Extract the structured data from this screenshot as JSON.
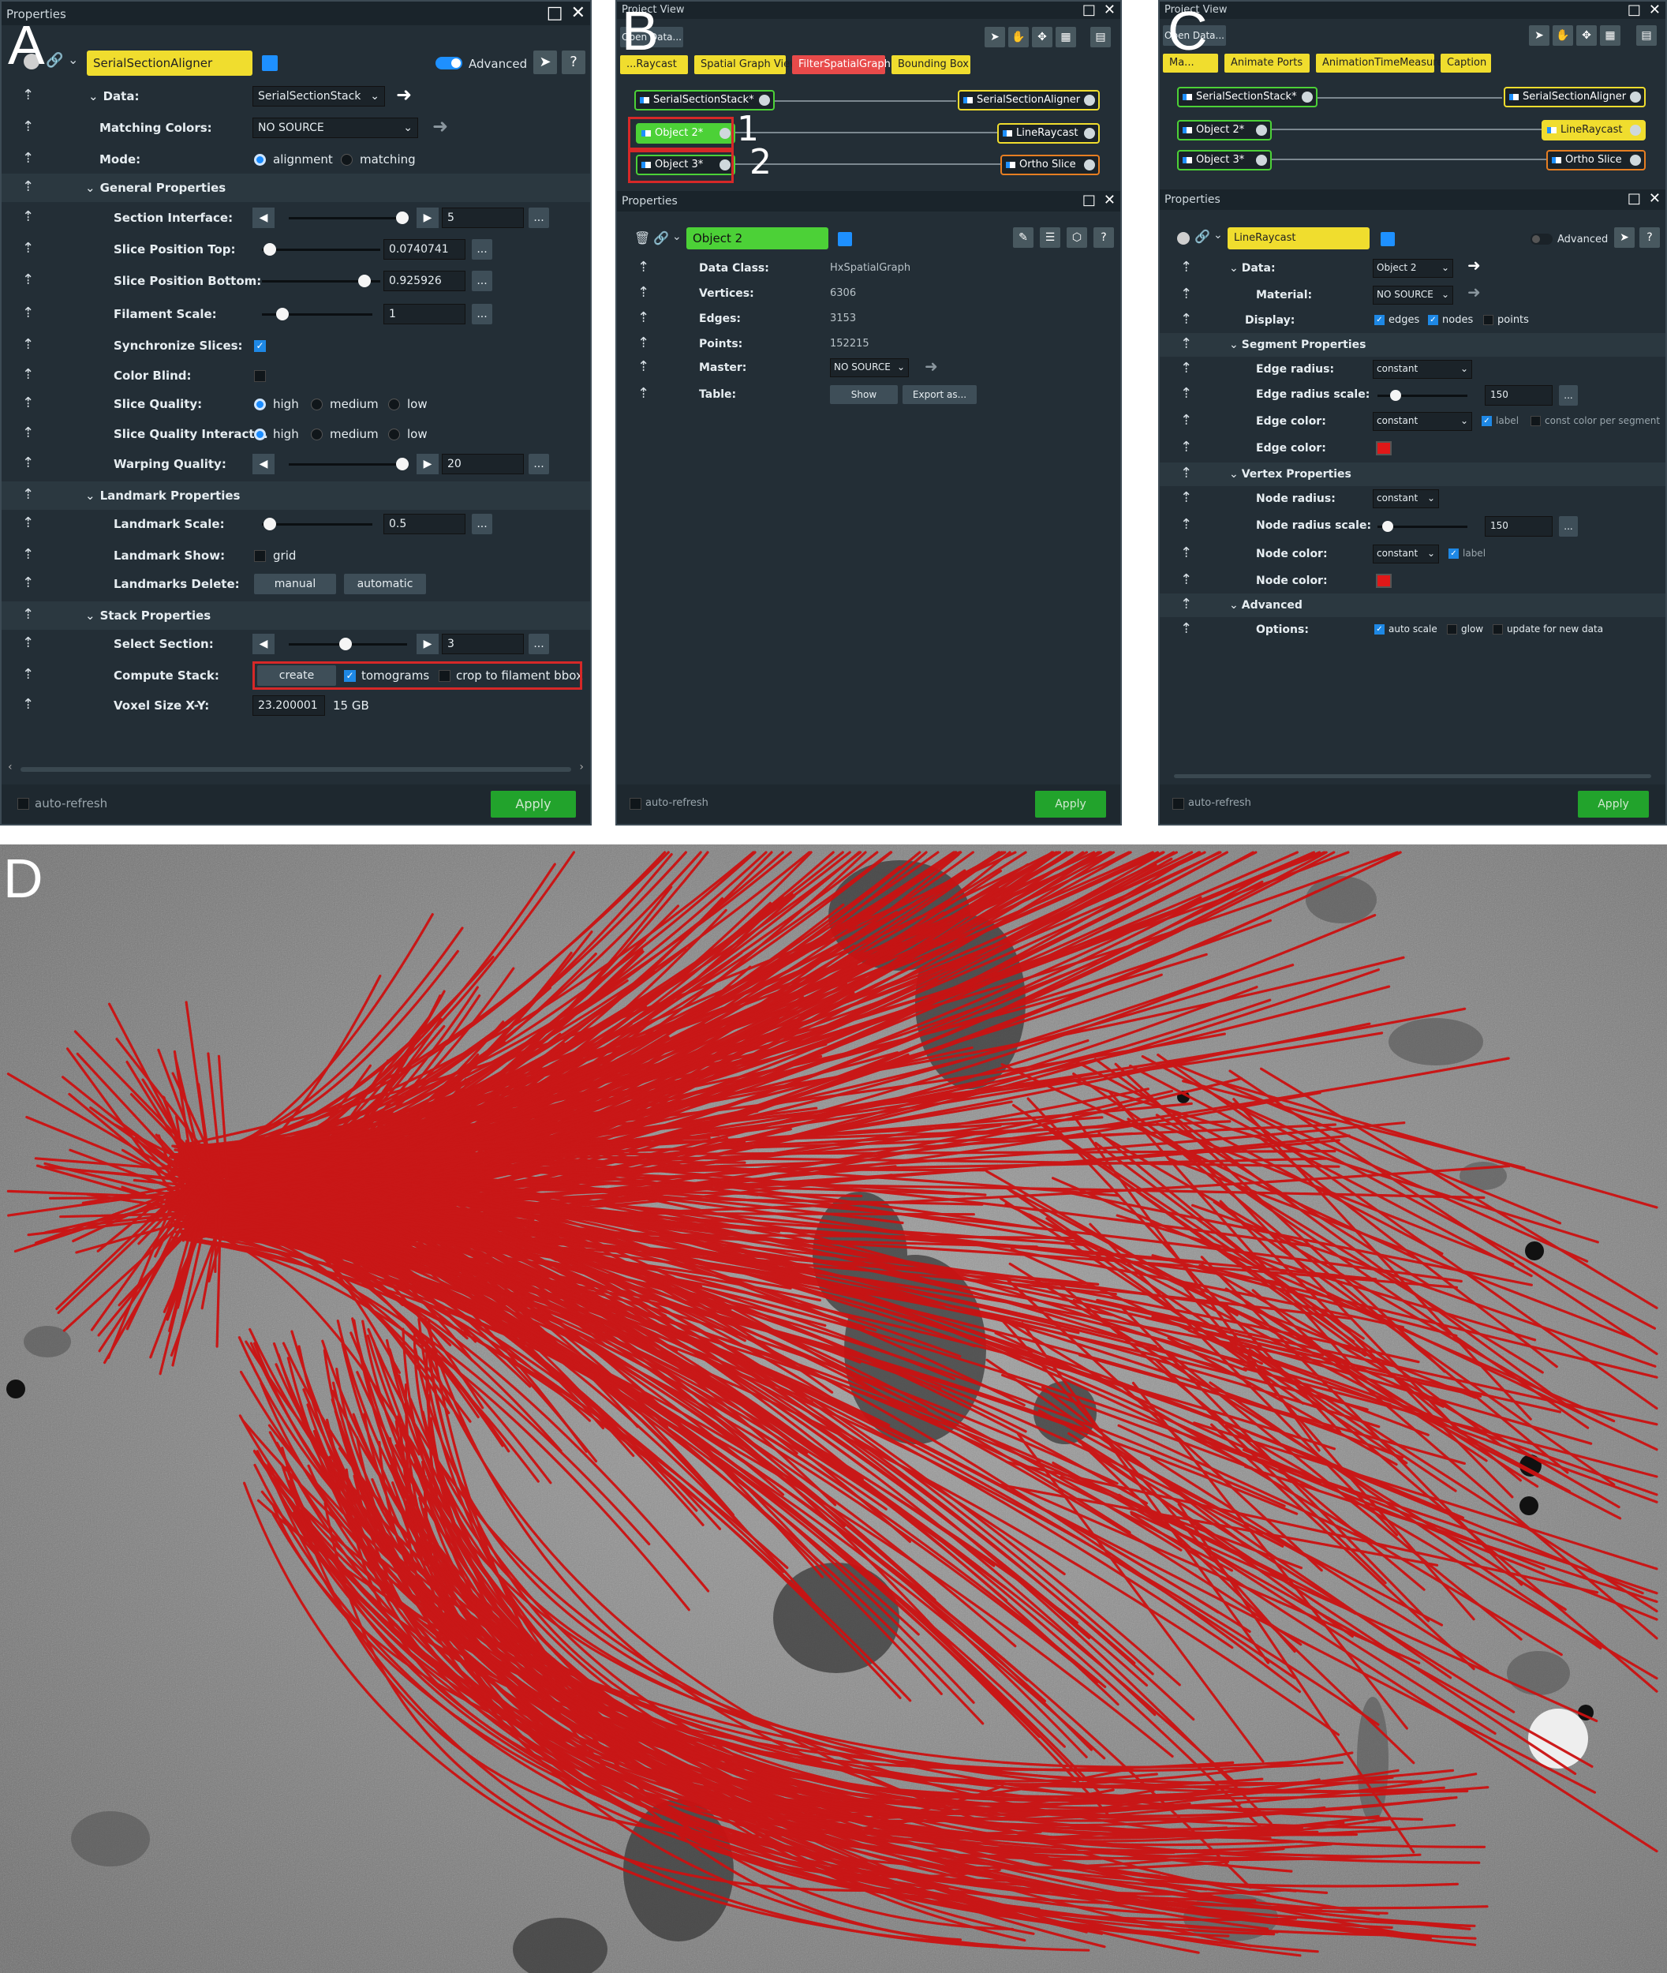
{
  "figure_labels": {
    "a": "A",
    "b": "B",
    "c": "C",
    "d": "D"
  },
  "panel_a": {
    "window_title": "Properties",
    "module_name": "SerialSectionAligner",
    "advanced_label": "Advanced",
    "rows": {
      "data_label": "Data:",
      "data_value": "SerialSectionStack",
      "matching_colors_label": "Matching Colors:",
      "matching_colors_value": "NO SOURCE",
      "mode_label": "Mode:",
      "mode_opt1": "alignment",
      "mode_opt2": "matching",
      "general_header": "General Properties",
      "section_interface_label": "Section Interface:",
      "section_interface_value": "5",
      "slice_top_label": "Slice Position Top:",
      "slice_top_value": "0.0740741",
      "slice_bottom_label": "Slice Position Bottom:",
      "slice_bottom_value": "0.925926",
      "filament_scale_label": "Filament Scale:",
      "filament_scale_value": "1",
      "sync_label": "Synchronize Slices:",
      "color_blind_label": "Color Blind:",
      "slice_quality_label": "Slice Quality:",
      "slice_quality_interact_label": "Slice Quality Interact...",
      "q_high": "high",
      "q_medium": "medium",
      "q_low": "low",
      "warping_label": "Warping Quality:",
      "warping_value": "20",
      "landmark_header": "Landmark Properties",
      "landmark_scale_label": "Landmark Scale:",
      "landmark_scale_value": "0.5",
      "landmark_show_label": "Landmark Show:",
      "landmark_show_opt": "grid",
      "landmarks_delete_label": "Landmarks Delete:",
      "manual_button": "manual",
      "automatic_button": "automatic",
      "stack_header": "Stack Properties",
      "select_section_label": "Select Section:",
      "select_section_value": "3",
      "compute_stack_label": "Compute Stack:",
      "create_button": "create",
      "tomograms_label": "tomograms",
      "crop_label": "crop to filament bbox",
      "voxel_label": "Voxel Size X-Y:",
      "voxel_value": "23.200001",
      "voxel_mem": "15 GB"
    },
    "auto_refresh": "auto-refresh",
    "apply": "Apply"
  },
  "panel_b": {
    "project_title": "Project View",
    "open_data": "Open Data...",
    "tabs": [
      "...Raycast",
      "Spatial Graph View",
      "FilterSpatialGraph",
      "Bounding Box"
    ],
    "tab_colors": [
      "#f0dd2e",
      "#f0dd2e",
      "#e84a4a",
      "#f0dd2e"
    ],
    "nodes": {
      "stack": "SerialSectionStack*",
      "aligner": "SerialSectionAligner",
      "obj2": "Object 2*",
      "obj3": "Object 3*",
      "lineraycast": "LineRaycast",
      "ortho": "Ortho Slice"
    },
    "callouts": [
      "1",
      "2"
    ],
    "properties_title": "Properties",
    "object_name": "Object 2",
    "fields": [
      {
        "label": "Data Class:",
        "value": "HxSpatialGraph"
      },
      {
        "label": "Vertices:",
        "value": "6306"
      },
      {
        "label": "Edges:",
        "value": "3153"
      },
      {
        "label": "Points:",
        "value": "152215"
      }
    ],
    "master_label": "Master:",
    "master_value": "NO SOURCE",
    "table_label": "Table:",
    "show_button": "Show",
    "export_button": "Export as...",
    "auto_refresh": "auto-refresh",
    "apply": "Apply"
  },
  "panel_c": {
    "project_title": "Project View",
    "open_data": "Open Data...",
    "tabs": [
      "Ma...",
      "Animate Ports",
      "AnimationTimeMeasure",
      "Caption"
    ],
    "nodes": {
      "stack": "SerialSectionStack*",
      "aligner": "SerialSectionAligner",
      "obj2": "Object 2*",
      "obj3": "Object 3*",
      "lineraycast": "LineRaycast",
      "ortho": "Ortho Slice"
    },
    "properties_title": "Properties",
    "module_name": "LineRaycast",
    "advanced_label": "Advanced",
    "rows": {
      "data_label": "Data:",
      "data_value": "Object 2",
      "material_label": "Material:",
      "material_value": "NO SOURCE",
      "display_label": "Display:",
      "disp_edges": "edges",
      "disp_nodes": "nodes",
      "disp_points": "points",
      "segment_header": "Segment Properties",
      "edge_radius_label": "Edge radius:",
      "edge_radius_value": "constant",
      "edge_radius_scale_label": "Edge radius scale:",
      "edge_radius_scale_value": "150",
      "edge_color_label": "Edge color:",
      "edge_color_value": "constant",
      "edge_color_label_opt": "label",
      "edge_color_const_opt": "const color per segment",
      "edge_color2_label": "Edge color:",
      "vertex_header": "Vertex Properties",
      "node_radius_label": "Node radius:",
      "node_radius_value": "constant",
      "node_radius_scale_label": "Node radius scale:",
      "node_radius_scale_value": "150",
      "node_color_label": "Node color:",
      "node_color_value": "constant",
      "node_color_label_opt": "label",
      "node_color2_label": "Node color:",
      "advanced_header": "Advanced",
      "options_label": "Options:",
      "opt_auto_scale": "auto scale",
      "opt_glow": "glow",
      "opt_update": "update for new data"
    },
    "auto_refresh": "auto-refresh",
    "apply": "Apply"
  },
  "colors": {
    "accent_yellow": "#f0dd2e",
    "accent_green": "#4cd137",
    "filament_red": "#cc1111",
    "callout_red": "#d62828",
    "apply_green": "#22a32c"
  }
}
